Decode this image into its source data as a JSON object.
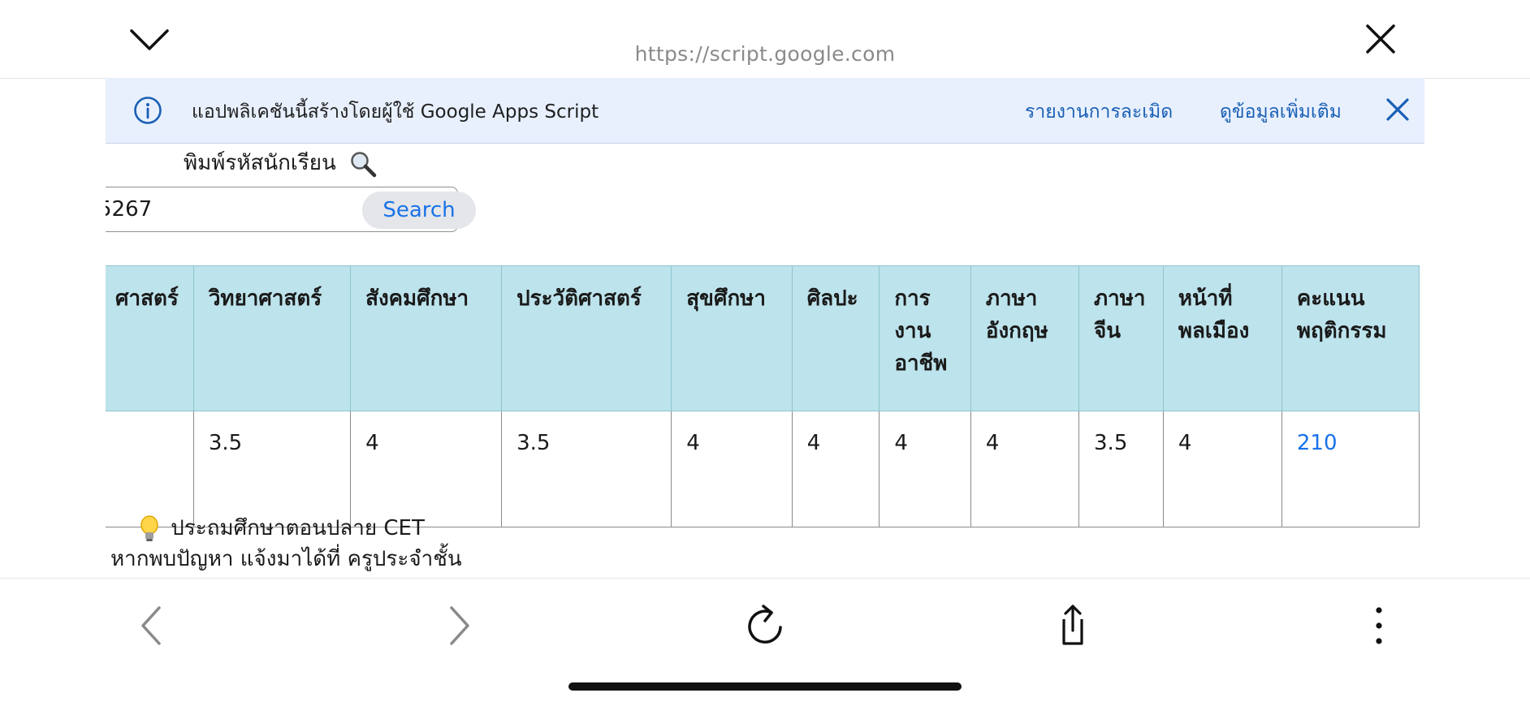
{
  "browser": {
    "url": "https://script.google.com",
    "icons": {
      "collapse": "chevron-down-icon",
      "close": "close-icon",
      "back": "chevron-left-icon",
      "forward": "chevron-right-icon",
      "reload": "reload-icon",
      "share": "share-icon",
      "more": "more-vertical-icon"
    }
  },
  "banner": {
    "message": "แอปพลิเคชันนี้สร้างโดยผู้ใช้ Google Apps Script",
    "report_link": "รายงานการละเมิด",
    "more_info_link": "ดูข้อมูลเพิ่มเติม",
    "icons": {
      "info": "info-icon",
      "dismiss": "close-icon"
    }
  },
  "search": {
    "prompt": "พิมพ์รหัสนักเรียน",
    "prompt_icon": "magnifier-icon",
    "input_value": "5267",
    "button_label": "Search"
  },
  "table": {
    "headers": [
      "ศาสตร์",
      "วิทยาศาสตร์",
      "สังคมศึกษา",
      "ประวัติศาสตร์",
      "สุขศึกษา",
      "ศิลปะ",
      "การ งาน อาชีพ",
      "ภาษา อังกฤษ",
      "ภาษา จีน",
      "หน้าที่ พลเมือง",
      "คะแนน พฤติกรรม"
    ],
    "row": [
      "",
      "3.5",
      "4",
      "3.5",
      "4",
      "4",
      "4",
      "4",
      "3.5",
      "4",
      "210"
    ]
  },
  "footer": {
    "line1": "ประถมศึกษาตอนปลาย CET",
    "line1_icon": "lightbulb-icon",
    "line2": "หากพบปัญหา แจ้งมาได้ที่ ครูประจำชั้น"
  },
  "colors": {
    "banner_bg": "#e8f0fe",
    "header_bg": "#bde3ec",
    "link": "#1a5fb4",
    "accent": "#1a73e8"
  }
}
